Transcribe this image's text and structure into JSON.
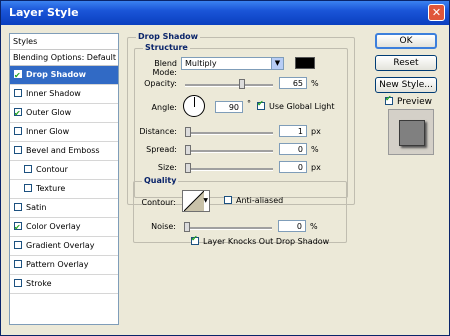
{
  "window": {
    "title": "Layer Style",
    "close_symbol": "✕"
  },
  "styles_panel": {
    "header": "Styles",
    "blending_options": "Blending Options: Default",
    "items": [
      {
        "label": "Drop Shadow",
        "checked": true,
        "selected": true,
        "sub": false
      },
      {
        "label": "Inner Shadow",
        "checked": false,
        "selected": false,
        "sub": false
      },
      {
        "label": "Outer Glow",
        "checked": true,
        "selected": false,
        "sub": false
      },
      {
        "label": "Inner Glow",
        "checked": false,
        "selected": false,
        "sub": false
      },
      {
        "label": "Bevel and Emboss",
        "checked": false,
        "selected": false,
        "sub": false
      },
      {
        "label": "Contour",
        "checked": false,
        "selected": false,
        "sub": true
      },
      {
        "label": "Texture",
        "checked": false,
        "selected": false,
        "sub": true
      },
      {
        "label": "Satin",
        "checked": false,
        "selected": false,
        "sub": false
      },
      {
        "label": "Color Overlay",
        "checked": true,
        "selected": false,
        "sub": false
      },
      {
        "label": "Gradient Overlay",
        "checked": false,
        "selected": false,
        "sub": false
      },
      {
        "label": "Pattern Overlay",
        "checked": false,
        "selected": false,
        "sub": false
      },
      {
        "label": "Stroke",
        "checked": false,
        "selected": false,
        "sub": false
      }
    ]
  },
  "drop_shadow": {
    "title": "Drop Shadow",
    "structure": {
      "title": "Structure",
      "blend_mode_label": "Blend Mode:",
      "blend_mode_value": "Multiply",
      "shadow_color": "#000000",
      "opacity_label": "Opacity:",
      "opacity_value": "65",
      "opacity_unit": "%",
      "angle_label": "Angle:",
      "angle_value": "90",
      "angle_unit": "°",
      "use_global_light_label": "Use Global Light",
      "use_global_light_checked": true,
      "distance_label": "Distance:",
      "distance_value": "1",
      "distance_unit": "px",
      "spread_label": "Spread:",
      "spread_value": "0",
      "spread_unit": "%",
      "size_label": "Size:",
      "size_value": "0",
      "size_unit": "px"
    },
    "quality": {
      "title": "Quality",
      "contour_label": "Contour:",
      "anti_aliased_label": "Anti-aliased",
      "anti_aliased_checked": false,
      "noise_label": "Noise:",
      "noise_value": "0",
      "noise_unit": "%"
    },
    "knocks_out_label": "Layer Knocks Out Drop Shadow",
    "knocks_out_checked": true
  },
  "buttons": {
    "ok": "OK",
    "reset": "Reset",
    "new_style": "New Style...",
    "preview_label": "Preview",
    "preview_checked": true
  }
}
